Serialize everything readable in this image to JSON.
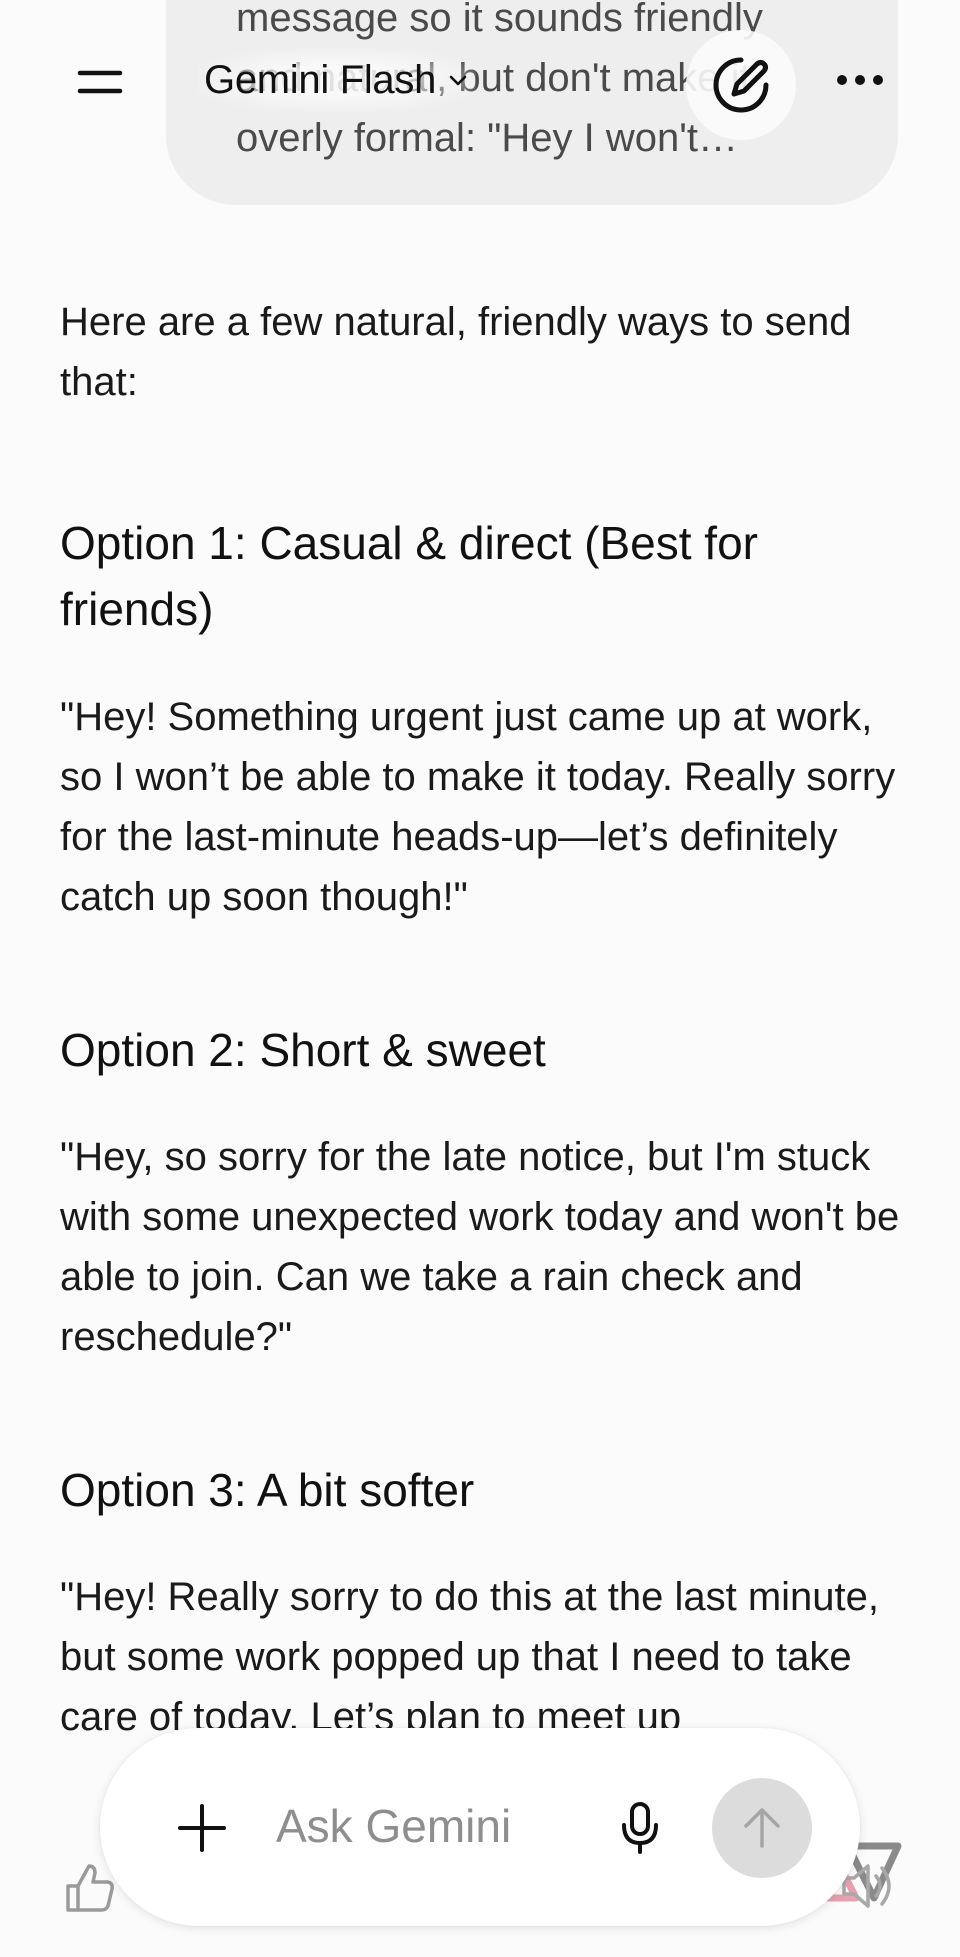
{
  "prompt_bubble": {
    "text": "message so it sounds friendly\nand natural, but don't make it\noverly formal: \"Hey I won't…"
  },
  "header": {
    "menu_icon": "hamburger-menu-icon",
    "model_name": "Gemini Flash",
    "model_chevron_icon": "chevron-down-icon",
    "new_chat_icon": "edit-pen-icon",
    "more_icon": "more-horizontal-icon"
  },
  "response": {
    "intro": "Here are a few natural, friendly ways to send that:",
    "options": [
      {
        "title": "Option 1: Casual & direct (Best for friends)",
        "text": "\"Hey! Something urgent just came up at work, so I won’t be able to make it today. Really sorry for the last-minute heads-up—let’s definitely catch up soon though!\""
      },
      {
        "title": "Option 2: Short & sweet",
        "text": "\"Hey, so sorry for the late notice, but I'm stuck with some unexpected work today and won't be able to join. Can we take a rain check and reschedule?\""
      },
      {
        "title": "Option 3: A bit softer",
        "text": "\"Hey! Really sorry to do this at the last minute, but some work popped up that I need to take care of today. Let’s plan to meet up"
      }
    ]
  },
  "actions": {
    "thumbs_up_icon": "thumbs-up-icon",
    "listen_icon": "speaker-icon"
  },
  "composer": {
    "add_icon": "plus-icon",
    "placeholder": "Ask Gemini",
    "mic_icon": "microphone-icon",
    "send_icon": "arrow-up-icon"
  },
  "colors": {
    "background": "#fbfbfb",
    "bubble": "#eeeeee",
    "send_button": "#dcdcdc",
    "watermark": "#e8a0b0"
  }
}
